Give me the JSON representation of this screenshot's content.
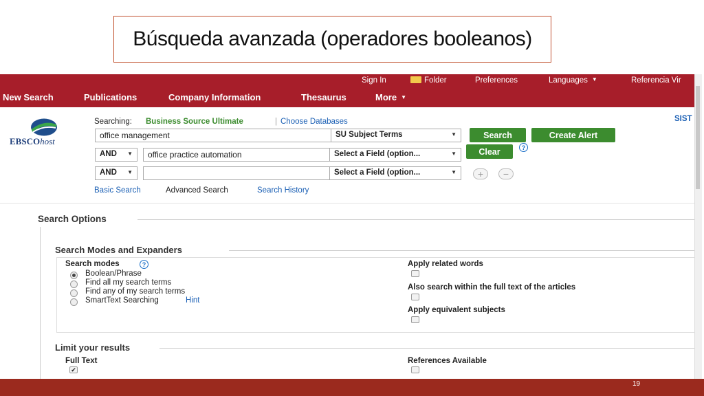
{
  "slide": {
    "title": "Búsqueda avanzada (operadores booleanos)",
    "page_number": "19"
  },
  "topbar": {
    "sign_in": "Sign In",
    "folder": "Folder",
    "preferences": "Preferences",
    "languages": "Languages",
    "referencia": "Referencia Vir"
  },
  "nav": {
    "new_search": "New Search",
    "publications": "Publications",
    "company_information": "Company Information",
    "thesaurus": "Thesaurus",
    "more": "More"
  },
  "logo": {
    "text_bold": "EBSCO",
    "text_italic": "host"
  },
  "search": {
    "searching_label": "Searching:",
    "database": "Business Source Ultimate",
    "separator": "|",
    "choose_databases": "Choose Databases",
    "right_cut": "SIST",
    "rows": [
      {
        "operator": "",
        "term": "office management",
        "field": "SU Subject Terms"
      },
      {
        "operator": "AND",
        "term": "office practice automation",
        "field": "Select a Field (option..."
      },
      {
        "operator": "AND",
        "term": "",
        "field": "Select a Field (option..."
      }
    ],
    "search_button": "Search",
    "create_alert_button": "Create Alert",
    "clear_button": "Clear",
    "help": "?",
    "add": "+",
    "remove": "−",
    "basic_search": "Basic Search",
    "advanced_search": "Advanced Search",
    "search_history": "Search History"
  },
  "options": {
    "title": "Search Options",
    "modes_title": "Search Modes and Expanders",
    "modes_label": "Search modes",
    "modes": [
      {
        "label": "Boolean/Phrase",
        "selected": true
      },
      {
        "label": "Find all my search terms",
        "selected": false
      },
      {
        "label": "Find any of my search terms",
        "selected": false
      },
      {
        "label": "SmartText Searching",
        "selected": false
      }
    ],
    "hint": "Hint",
    "apply_related": "Apply related words",
    "also_search_full_text": "Also search within the full text of the articles",
    "apply_equivalent": "Apply equivalent subjects",
    "limit_title": "Limit your results",
    "full_text": "Full Text",
    "references_available": "References Available",
    "check_mark": "✔"
  },
  "colors": {
    "brand_red": "#a71e2a",
    "button_green": "#3c8c2f",
    "link_blue": "#1a5fb4",
    "footer": "#9b2a1e"
  }
}
